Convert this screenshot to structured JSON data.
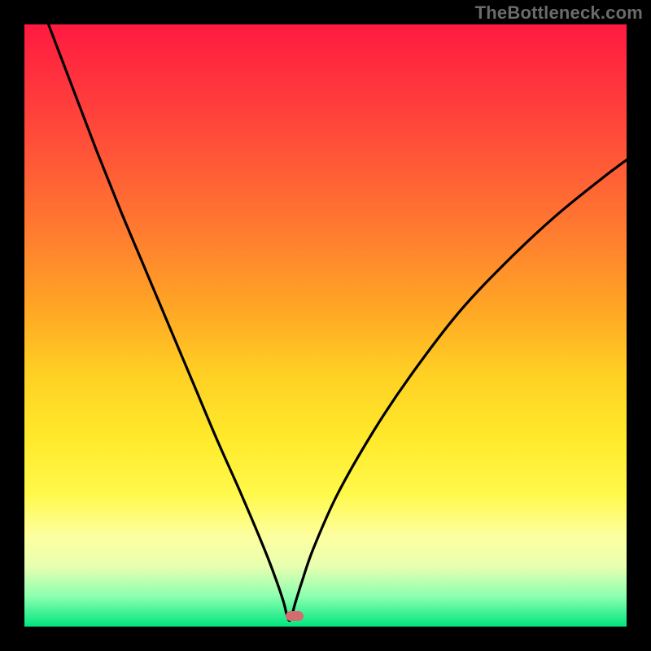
{
  "watermark": {
    "text": "TheBottleneck.com"
  },
  "chart_data": {
    "type": "line",
    "title": "",
    "xlabel": "",
    "ylabel": "",
    "xlim": [
      0,
      100
    ],
    "ylim": [
      0,
      100
    ],
    "grid": false,
    "legend": false,
    "bottleneck_minimum": {
      "x": 44,
      "y": 0
    },
    "marker": {
      "x_pct": 44.8,
      "y_pct": 98.2,
      "color": "#d56a6f"
    },
    "series": [
      {
        "name": "bottleneck-curve",
        "x": [
          4.0,
          8.0,
          12.0,
          16.0,
          20.0,
          24.0,
          28.0,
          32.0,
          36.0,
          40.0,
          42.0,
          43.0,
          44.0,
          45.0,
          46.0,
          48.0,
          52.0,
          58.0,
          64.0,
          72.0,
          80.0,
          88.0,
          96.0,
          100.0
        ],
        "values": [
          100.0,
          89.5,
          79.0,
          69.0,
          59.5,
          50.0,
          40.5,
          31.0,
          22.0,
          12.5,
          7.2,
          4.2,
          1.0,
          4.0,
          7.2,
          13.0,
          22.0,
          32.5,
          41.5,
          52.0,
          60.5,
          68.0,
          74.5,
          77.5
        ]
      }
    ],
    "colors": {
      "curve": "#000000",
      "background_gradient": [
        "#ff1a40",
        "#ffe82a",
        "#00e57e"
      ],
      "frame": "#000000"
    }
  }
}
